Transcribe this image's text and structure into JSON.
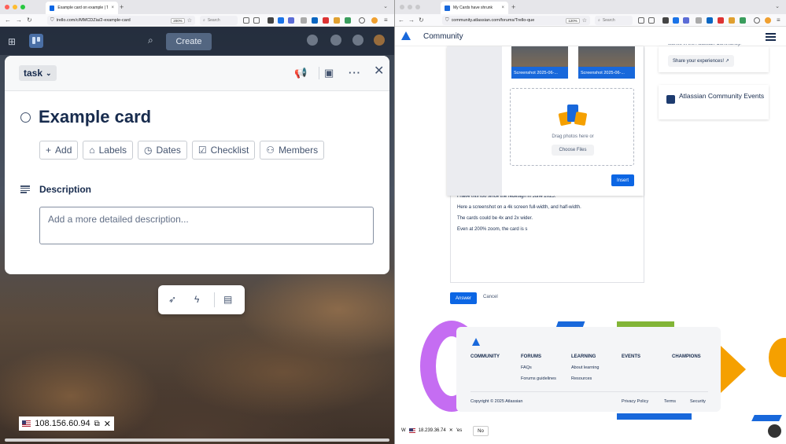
{
  "left_browser": {
    "tab_title": "Example card on example | Trel",
    "url": "trello.com/c/MMCDZia/2-example-card",
    "zoom": "200%",
    "search_placeholder": "Search",
    "new_tab": "+"
  },
  "trello": {
    "create_label": "Create",
    "card": {
      "list_name": "task",
      "title": "Example card",
      "actions": [
        {
          "label": "Add",
          "icon": "plus-icon",
          "glyph": "+"
        },
        {
          "label": "Labels",
          "icon": "tag-icon",
          "glyph": "⌂"
        },
        {
          "label": "Dates",
          "icon": "clock-icon",
          "glyph": "◷"
        },
        {
          "label": "Checklist",
          "icon": "checkbox-icon",
          "glyph": "☑"
        },
        {
          "label": "Members",
          "icon": "add-member-icon",
          "glyph": "⚇"
        }
      ],
      "description_heading": "Description",
      "description_placeholder": "Add a more detailed description..."
    },
    "ip_address": "108.156.60.94"
  },
  "right_browser": {
    "tab_title": "My Cards have shrunk",
    "url": "community.atlassian.com/forums/Trello-que",
    "zoom": "120%",
    "search_placeholder": "Search"
  },
  "community": {
    "brand": "Community",
    "upload": {
      "thumb1_caption": "Screenshot 2025-06-...",
      "thumb2_caption": "Screenshot 2025-06-...",
      "drag_text": "Drag photos here or",
      "choose_files": "Choose Files",
      "insert": "Insert"
    },
    "editor_lines": [
      "I have this too since the redesign in June 2025.",
      "Here a screenshot on a 4k screen full-width, and half-width.",
      "The cards could be 4x and 2x wider.",
      "Even at 200% zoom, the card is s"
    ],
    "answer_button": "Answer",
    "cancel_button": "Cancel",
    "sidebar": {
      "partial_text": "stories in the Atlassian Community.",
      "share_button": "Share your experiences! ↗",
      "events_title": "Atlassian Community Events"
    },
    "footer": {
      "columns": [
        {
          "heading": "COMMUNITY",
          "links": []
        },
        {
          "heading": "FORUMS",
          "links": [
            "FAQs",
            "Forums guidelines"
          ]
        },
        {
          "heading": "LEARNING",
          "links": [
            "About learning",
            "Resources"
          ]
        },
        {
          "heading": "EVENTS",
          "links": []
        },
        {
          "heading": "CHAMPIONS",
          "links": []
        }
      ],
      "copyright": "Copyright © 2025 Atlassian",
      "bottom_links": [
        "Privacy Policy",
        "Terms",
        "Security"
      ]
    },
    "bottom_bar": {
      "prefix": "W",
      "ip_address": "18.239.36.74",
      "yes_partial": "'es",
      "no": "No"
    }
  },
  "colors": {
    "atlassian_blue": "#0c66e4",
    "trello_text": "#172b4d",
    "accent_green": "#82b536",
    "accent_purple": "#c56df2",
    "accent_orange": "#f5a000"
  }
}
